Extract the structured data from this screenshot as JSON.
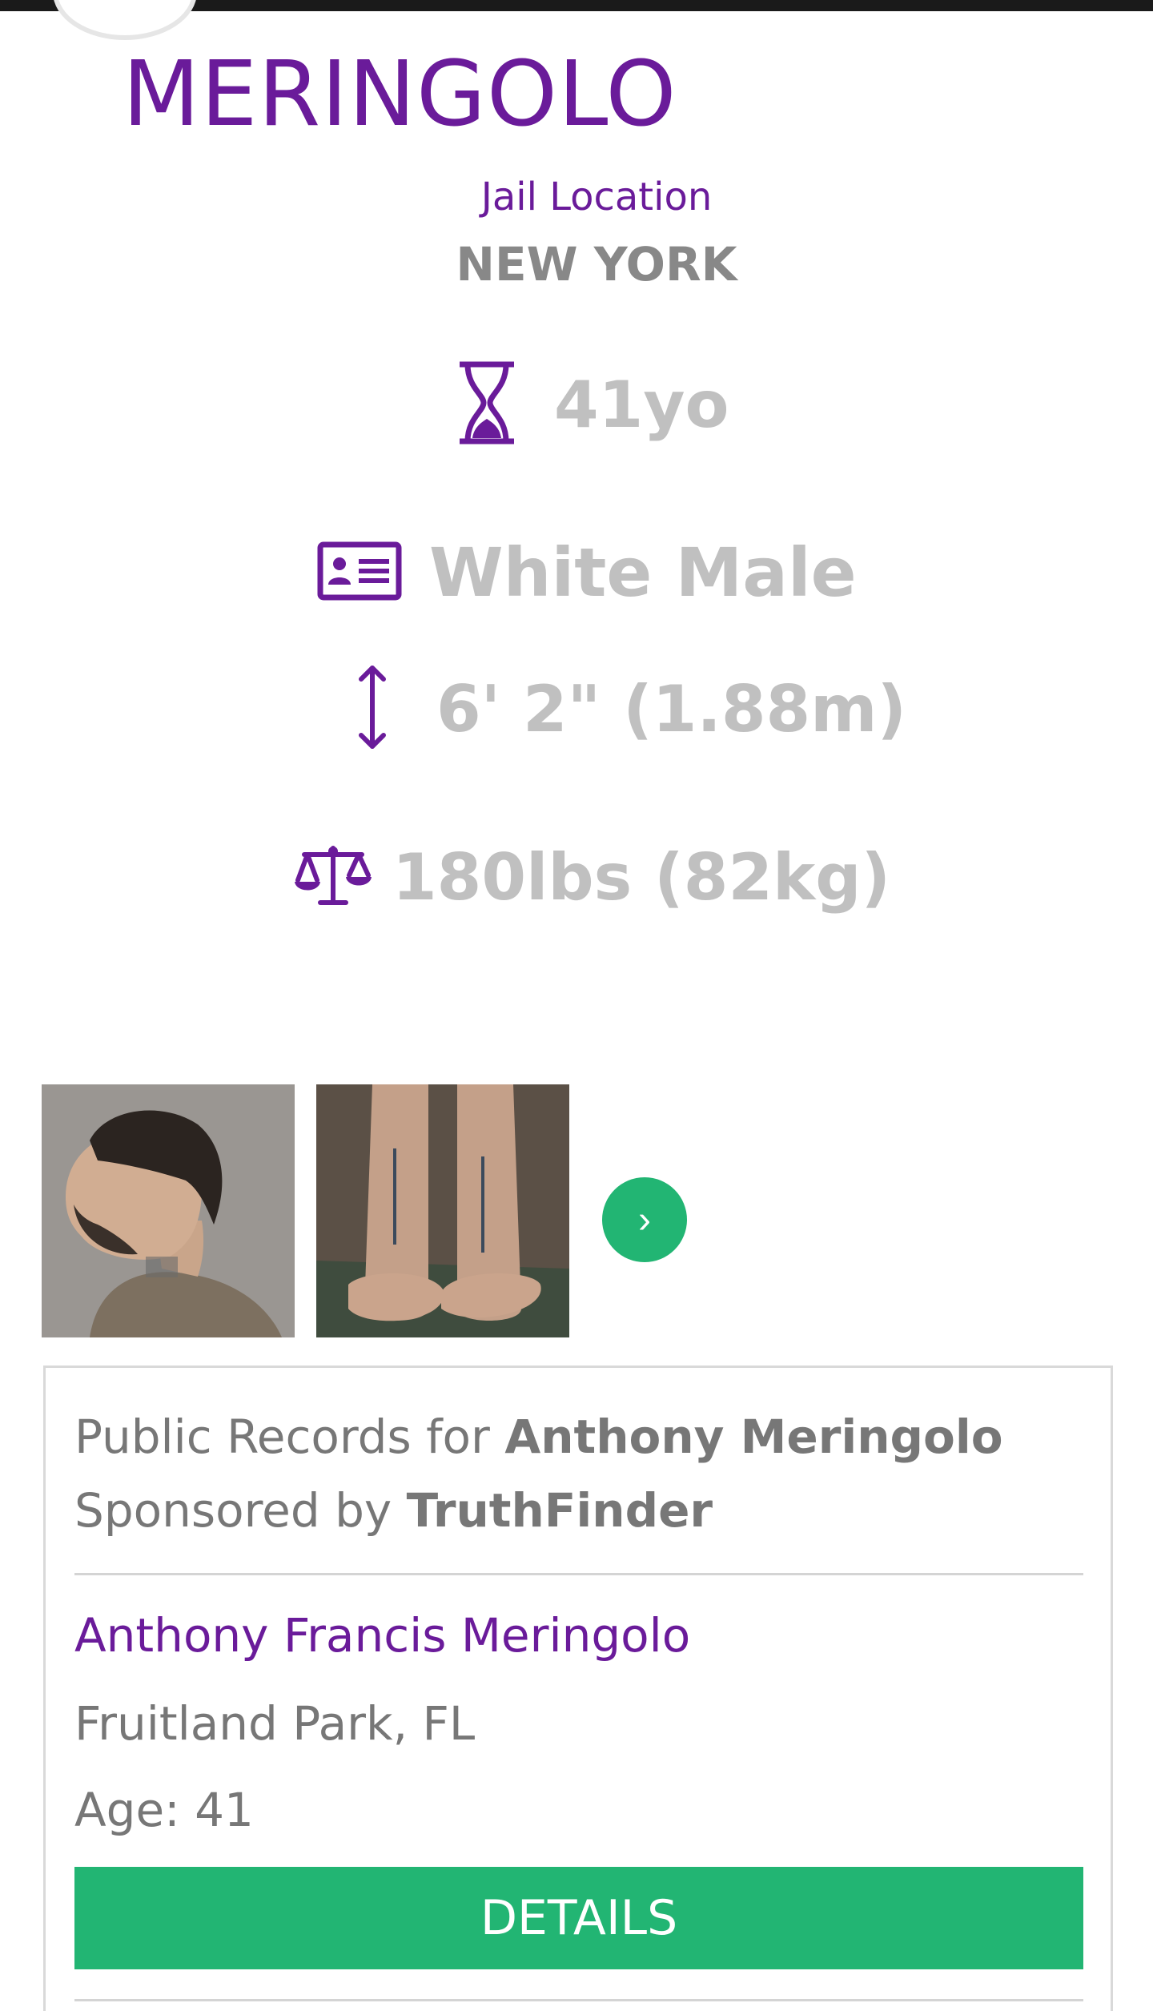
{
  "profile": {
    "surname": "MERINGOLO",
    "jail_location_label": "Jail Location",
    "jail_location_value": "NEW YORK"
  },
  "stats": {
    "age": {
      "icon": "hourglass-icon",
      "value": "41yo"
    },
    "race_gender": {
      "icon": "id-card-icon",
      "value": "White Male"
    },
    "height": {
      "icon": "vertical-arrows-icon",
      "value": "6' 2\" (1.88m)"
    },
    "weight": {
      "icon": "scale-icon",
      "value": "180lbs (82kg)"
    }
  },
  "gallery": {
    "photos": [
      "mugshot-profile-photo",
      "tattoo-arms-photo"
    ],
    "next_label": "›"
  },
  "sponsored_card": {
    "prefix": "Public Records for ",
    "person": "Anthony Meringolo",
    "sponsor_prefix": "Sponsored by ",
    "sponsor": "TruthFinder",
    "result": {
      "name": "Anthony Francis Meringolo",
      "location": "Fruitland Park, FL",
      "age": "Age: 41"
    },
    "details_label": "DETAILS"
  },
  "colors": {
    "accent_purple": "#6a1b9a",
    "accent_green": "#22b573",
    "muted_text": "#c0c0c0"
  }
}
